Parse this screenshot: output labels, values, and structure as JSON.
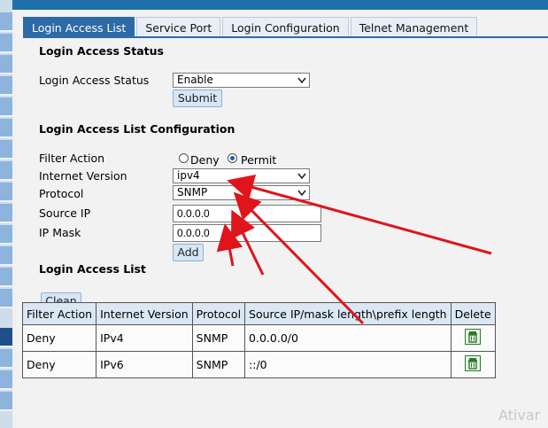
{
  "tabs": [
    {
      "label": "Login Access List",
      "active": true
    },
    {
      "label": "Service Port",
      "active": false
    },
    {
      "label": "Login Configuration",
      "active": false
    },
    {
      "label": "Telnet Management",
      "active": false
    }
  ],
  "status_section": {
    "title": "Login Access Status",
    "field_label": "Login Access Status",
    "field_value": "Enable",
    "submit_label": "Submit"
  },
  "config_section": {
    "title": "Login Access List Configuration",
    "filter_label": "Filter Action",
    "deny_label": "Deny",
    "permit_label": "Permit",
    "selected_filter": "Permit",
    "version_label": "Internet Version",
    "version_value": "ipv4",
    "protocol_label": "Protocol",
    "protocol_value": "SNMP",
    "source_ip_label": "Source IP",
    "source_ip_value": "0.0.0.0",
    "mask_label": "IP Mask",
    "mask_value": "0.0.0.0",
    "add_label": "Add"
  },
  "list_section": {
    "title": "Login Access List",
    "clean_label": "Clean",
    "columns": [
      "Filter Action",
      "Internet Version",
      "Protocol",
      "Source IP/mask length\\prefix length",
      "Delete"
    ],
    "rows": [
      {
        "filter_action": "Deny",
        "version": "IPv4",
        "protocol": "SNMP",
        "source": "0.0.0.0/0"
      },
      {
        "filter_action": "Deny",
        "version": "IPv6",
        "protocol": "SNMP",
        "source": "::/0"
      }
    ]
  },
  "watermark": "Ativar",
  "colors": {
    "accent": "#2d6aa6",
    "annotation_arrow": "#e0141b",
    "delete_icon": "#2a7a2a"
  },
  "icons": [
    "chevron-down-icon",
    "radio-icon",
    "trash-icon"
  ]
}
